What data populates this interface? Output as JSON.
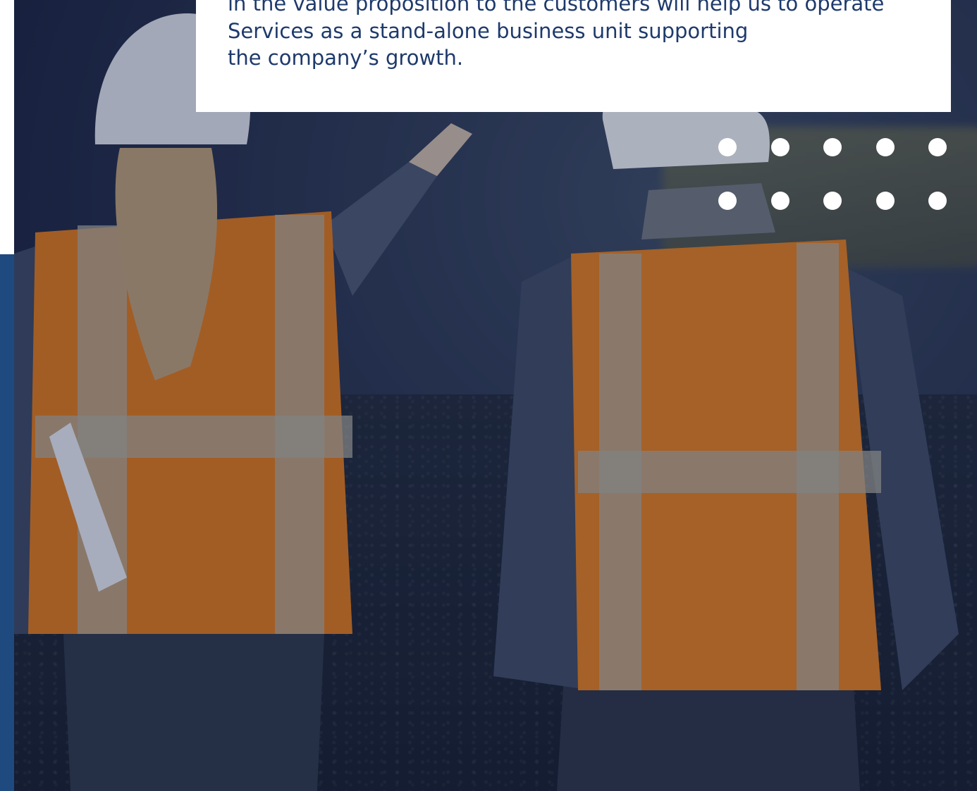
{
  "quote": {
    "lines": [
      "in the value proposition to the customers will help us to operate",
      "Services as a stand-alone business unit supporting",
      "the company’s growth."
    ]
  },
  "colors": {
    "navy": "#1e4a7f",
    "text": "#1e3a6b",
    "vest": "#e8861e",
    "overlay": "#142046"
  },
  "decor": {
    "dot_rows": 2,
    "dot_cols": 5
  }
}
